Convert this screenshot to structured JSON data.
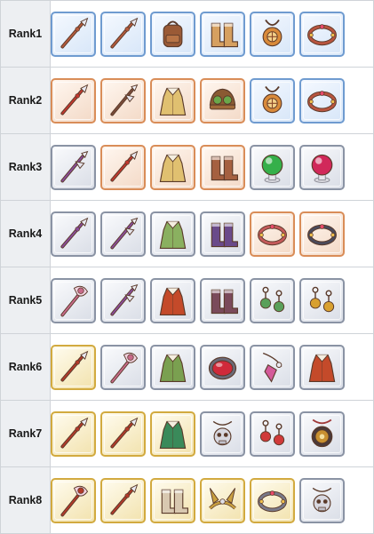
{
  "colors": {
    "frame_blue": "#6f9bd0",
    "frame_copper": "#d98d58",
    "frame_silver": "#8a93a4",
    "frame_gold": "#d2aa3f",
    "label_bg": "#edeff2"
  },
  "ranks": [
    {
      "label": "Rank1",
      "items": [
        {
          "icon": "spear-icon",
          "frame": "blue",
          "color": "#b55a3c"
        },
        {
          "icon": "spear-icon",
          "frame": "blue",
          "color": "#b55a3c"
        },
        {
          "icon": "backpack-icon",
          "frame": "blue",
          "color": "#9a5a36"
        },
        {
          "icon": "boots-icon",
          "frame": "blue",
          "color": "#d6a060"
        },
        {
          "icon": "amulet-icon",
          "frame": "blue",
          "color": "#d98a3a"
        },
        {
          "icon": "bracelet-icon",
          "frame": "blue",
          "color": "#b8553f"
        }
      ]
    },
    {
      "label": "Rank2",
      "items": [
        {
          "icon": "spear-icon",
          "frame": "copper",
          "color": "#c2382f"
        },
        {
          "icon": "halberd-icon",
          "frame": "copper",
          "color": "#7a4c3a"
        },
        {
          "icon": "robe-icon",
          "frame": "copper",
          "color": "#e0c070"
        },
        {
          "icon": "goggles-cap-icon",
          "frame": "copper",
          "color": "#8a5a32"
        },
        {
          "icon": "amulet-icon",
          "frame": "blue",
          "color": "#d98a3a"
        },
        {
          "icon": "bracelet-icon",
          "frame": "blue",
          "color": "#b8553f"
        }
      ]
    },
    {
      "label": "Rank3",
      "items": [
        {
          "icon": "halberd-icon",
          "frame": "silver",
          "color": "#8a4d9a"
        },
        {
          "icon": "spear-icon",
          "frame": "copper",
          "color": "#c2382f"
        },
        {
          "icon": "robe-icon",
          "frame": "copper",
          "color": "#e0c070"
        },
        {
          "icon": "boots-icon",
          "frame": "copper",
          "color": "#a56040"
        },
        {
          "icon": "orb-icon",
          "frame": "silver",
          "color": "#35b04a"
        },
        {
          "icon": "orb-icon",
          "frame": "silver",
          "color": "#d1285a"
        }
      ]
    },
    {
      "label": "Rank4",
      "items": [
        {
          "icon": "spear-icon",
          "frame": "silver",
          "color": "#8a4d9a"
        },
        {
          "icon": "halberd-icon",
          "frame": "silver",
          "color": "#8a4d9a"
        },
        {
          "icon": "robe-icon",
          "frame": "silver",
          "color": "#8ab060"
        },
        {
          "icon": "boots-icon",
          "frame": "silver",
          "color": "#6a4a8a"
        },
        {
          "icon": "bracelet-icon",
          "frame": "copper",
          "color": "#c45a5a"
        },
        {
          "icon": "bracelet-icon",
          "frame": "copper",
          "color": "#4a4a5a"
        }
      ]
    },
    {
      "label": "Rank5",
      "items": [
        {
          "icon": "staff-icon",
          "frame": "silver",
          "color": "#c86a8a"
        },
        {
          "icon": "halberd-icon",
          "frame": "silver",
          "color": "#8a4d9a"
        },
        {
          "icon": "robe-icon",
          "frame": "silver",
          "color": "#c44a2a"
        },
        {
          "icon": "boots-icon",
          "frame": "silver",
          "color": "#7a4a5a"
        },
        {
          "icon": "earring-icon",
          "frame": "silver",
          "color": "#5aa05a"
        },
        {
          "icon": "earring-icon",
          "frame": "silver",
          "color": "#d8a030"
        }
      ]
    },
    {
      "label": "Rank6",
      "items": [
        {
          "icon": "spear-icon",
          "frame": "gold",
          "color": "#b33a2a"
        },
        {
          "icon": "staff-icon",
          "frame": "silver",
          "color": "#c86a8a"
        },
        {
          "icon": "robe-icon",
          "frame": "silver",
          "color": "#7aa050"
        },
        {
          "icon": "gem-icon",
          "frame": "silver",
          "color": "#d02a3a"
        },
        {
          "icon": "pendant-icon",
          "frame": "silver",
          "color": "#d45a9a"
        },
        {
          "icon": "robe-icon",
          "frame": "silver",
          "color": "#c44a2a"
        }
      ]
    },
    {
      "label": "Rank7",
      "items": [
        {
          "icon": "spear-icon",
          "frame": "gold",
          "color": "#b33a2a"
        },
        {
          "icon": "spear-icon",
          "frame": "gold",
          "color": "#b33a2a"
        },
        {
          "icon": "robe-icon",
          "frame": "gold",
          "color": "#3a8a5a"
        },
        {
          "icon": "skull-pendant-icon",
          "frame": "silver",
          "color": "#8a8a9a"
        },
        {
          "icon": "earring-icon",
          "frame": "silver",
          "color": "#d03a3a"
        },
        {
          "icon": "medallion-icon",
          "frame": "silver",
          "color": "#c89030"
        }
      ]
    },
    {
      "label": "Rank8",
      "items": [
        {
          "icon": "staff-icon",
          "frame": "gold",
          "color": "#b33a2a"
        },
        {
          "icon": "spear-icon",
          "frame": "gold",
          "color": "#b33a2a"
        },
        {
          "icon": "boots-icon",
          "frame": "gold",
          "color": "#d8c8b0"
        },
        {
          "icon": "tiara-icon",
          "frame": "gold",
          "color": "#c9a040"
        },
        {
          "icon": "bracelet-icon",
          "frame": "gold",
          "color": "#7a7a8a"
        },
        {
          "icon": "skull-pendant-icon",
          "frame": "silver",
          "color": "#8a8a9a"
        }
      ]
    }
  ]
}
